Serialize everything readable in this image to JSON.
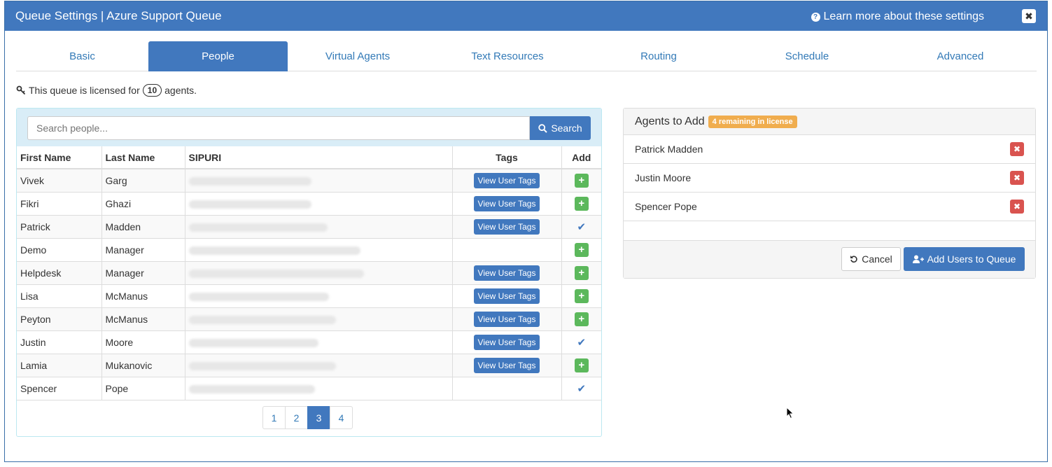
{
  "header": {
    "title": "Queue Settings | Azure Support Queue",
    "learn_more": "Learn more about these settings",
    "close_glyph": "✖"
  },
  "tabs": [
    {
      "label": "Basic",
      "active": false
    },
    {
      "label": "People",
      "active": true
    },
    {
      "label": "Virtual Agents",
      "active": false
    },
    {
      "label": "Text Resources",
      "active": false
    },
    {
      "label": "Routing",
      "active": false
    },
    {
      "label": "Schedule",
      "active": false
    },
    {
      "label": "Advanced",
      "active": false
    }
  ],
  "license": {
    "prefix": "This queue is licensed for",
    "count": "10",
    "suffix": "agents."
  },
  "search": {
    "placeholder": "Search people...",
    "button_label": "Search"
  },
  "table": {
    "columns": [
      "First Name",
      "Last Name",
      "SIPURI",
      "Tags",
      "Add"
    ],
    "rows": [
      {
        "first": "Vivek",
        "last": "Garg",
        "tags_label": "View User Tags",
        "status": "add"
      },
      {
        "first": "Fikri",
        "last": "Ghazi",
        "tags_label": "View User Tags",
        "status": "add"
      },
      {
        "first": "Patrick",
        "last": "Madden",
        "tags_label": "View User Tags",
        "status": "added"
      },
      {
        "first": "Demo",
        "last": "Manager",
        "tags_label": "",
        "status": "add"
      },
      {
        "first": "Helpdesk",
        "last": "Manager",
        "tags_label": "View User Tags",
        "status": "add"
      },
      {
        "first": "Lisa",
        "last": "McManus",
        "tags_label": "View User Tags",
        "status": "add"
      },
      {
        "first": "Peyton",
        "last": "McManus",
        "tags_label": "View User Tags",
        "status": "add"
      },
      {
        "first": "Justin",
        "last": "Moore",
        "tags_label": "View User Tags",
        "status": "added"
      },
      {
        "first": "Lamia",
        "last": "Mukanovic",
        "tags_label": "View User Tags",
        "status": "add"
      },
      {
        "first": "Spencer",
        "last": "Pope",
        "tags_label": "",
        "status": "added"
      }
    ]
  },
  "pagination": {
    "pages": [
      "1",
      "2",
      "3",
      "4"
    ],
    "active": "3"
  },
  "agents_to_add": {
    "title": "Agents to Add",
    "badge": "4 remaining in license",
    "agents": [
      "Patrick Madden",
      "Justin Moore",
      "Spencer Pope"
    ],
    "cancel_label": "Cancel",
    "add_label": "Add Users to Queue"
  },
  "colors": {
    "primary": "#4178be",
    "success": "#5cb85c",
    "danger": "#d9534f",
    "warning": "#f0ad4e"
  }
}
